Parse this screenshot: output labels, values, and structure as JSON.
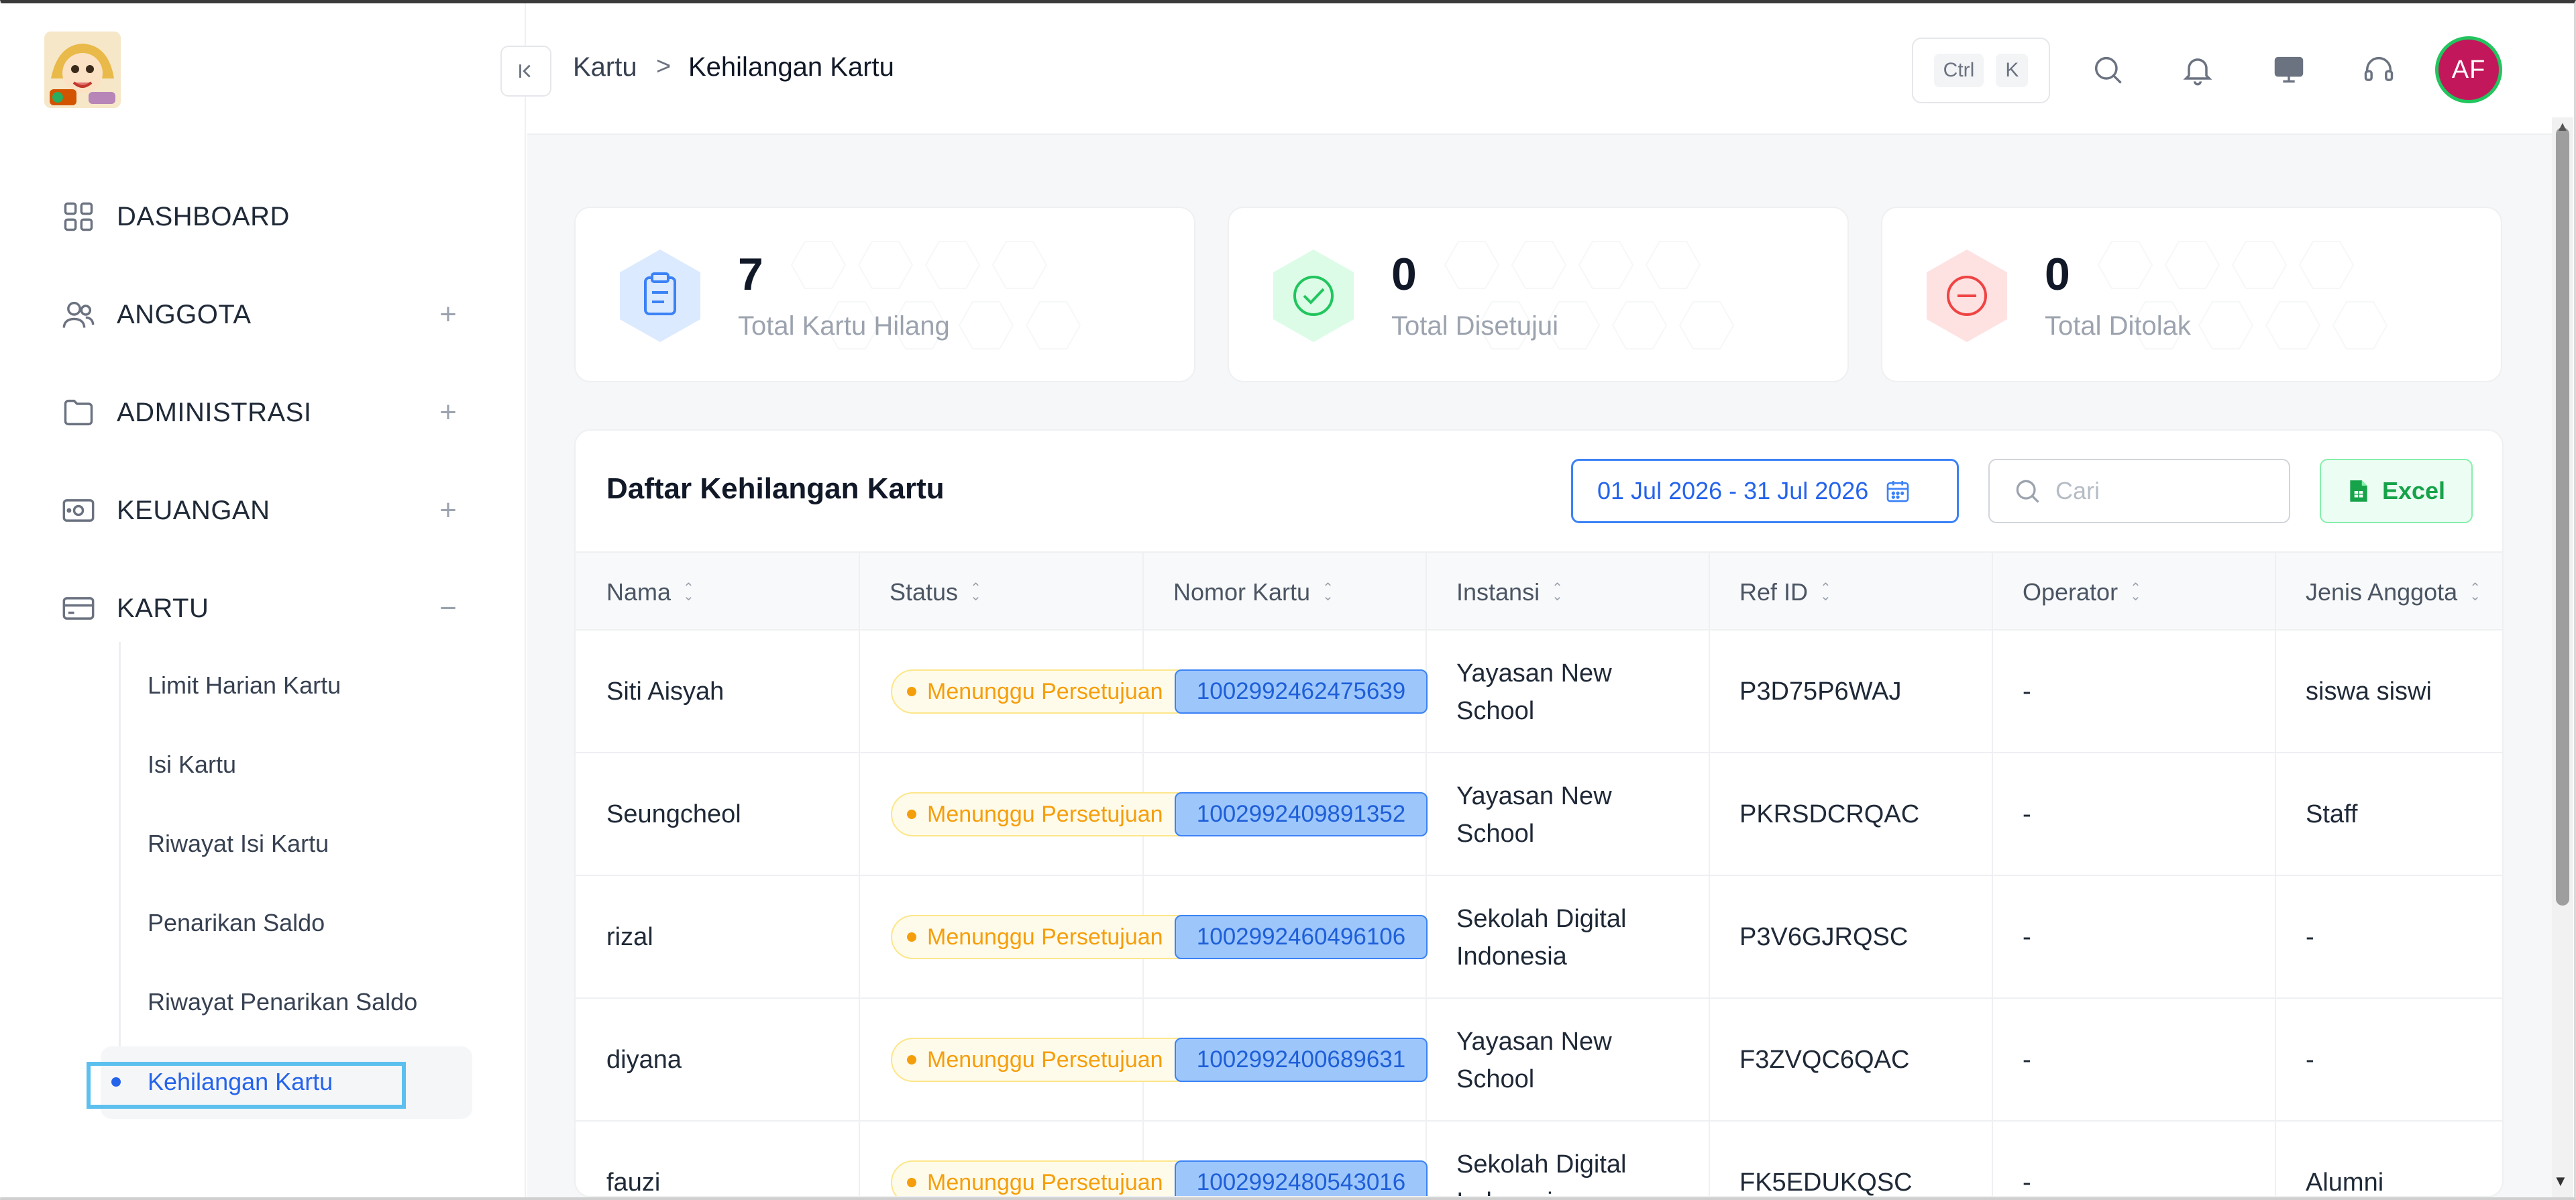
{
  "header": {
    "breadcrumb": [
      "Kartu",
      "Kehilangan Kartu"
    ],
    "breadcrumb_separator": ">",
    "shortcut_keys": [
      "Ctrl",
      "K"
    ],
    "avatar_initials": "AF"
  },
  "sidebar": {
    "items": [
      {
        "label": "DASHBOARD",
        "icon": "grid-icon"
      },
      {
        "label": "ANGGOTA",
        "icon": "users-icon",
        "toggle": "+"
      },
      {
        "label": "ADMINISTRASI",
        "icon": "folder-icon",
        "toggle": "+"
      },
      {
        "label": "KEUANGAN",
        "icon": "wallet-icon",
        "toggle": "+"
      },
      {
        "label": "KARTU",
        "icon": "card-icon",
        "toggle": "−"
      }
    ],
    "kartu_subitems": [
      "Limit Harian Kartu",
      "Isi Kartu",
      "Riwayat Isi Kartu",
      "Penarikan Saldo",
      "Riwayat Penarikan Saldo"
    ],
    "active_subitem": "Kehilangan Kartu"
  },
  "stats": [
    {
      "value": "7",
      "label": "Total Kartu Hilang",
      "color": "#3b82f6"
    },
    {
      "value": "0",
      "label": "Total Disetujui",
      "color": "#22c55e"
    },
    {
      "value": "0",
      "label": "Total Ditolak",
      "color": "#ef4444"
    }
  ],
  "panel": {
    "title": "Daftar Kehilangan Kartu",
    "date_range": "01 Jul 2026 - 31 Jul 2026",
    "search_placeholder": "Cari",
    "excel_label": "Excel"
  },
  "table": {
    "columns": [
      "Nama",
      "Status",
      "Nomor Kartu",
      "Instansi",
      "Ref ID",
      "Operator",
      "Jenis Anggota"
    ],
    "rows": [
      {
        "nama": "Siti Aisyah",
        "status": "Menunggu Persetujuan",
        "nomor": "1002992462475639",
        "instansi": [
          "Yayasan New",
          "School"
        ],
        "ref": "P3D75P6WAJ",
        "operator": "-",
        "jenis": "siswa siswi"
      },
      {
        "nama": "Seungcheol",
        "status": "Menunggu Persetujuan",
        "nomor": "1002992409891352",
        "instansi": [
          "Yayasan New",
          "School"
        ],
        "ref": "PKRSDCRQAC",
        "operator": "-",
        "jenis": "Staff"
      },
      {
        "nama": "rizal",
        "status": "Menunggu Persetujuan",
        "nomor": "1002992460496106",
        "instansi": [
          "Sekolah Digital",
          "Indonesia"
        ],
        "ref": "P3V6GJRQSC",
        "operator": "-",
        "jenis": "-"
      },
      {
        "nama": "diyana",
        "status": "Menunggu Persetujuan",
        "nomor": "1002992400689631",
        "instansi": [
          "Yayasan New",
          "School"
        ],
        "ref": "F3ZVQC6QAC",
        "operator": "-",
        "jenis": "-"
      },
      {
        "nama": "fauzi",
        "status": "Menunggu Persetujuan",
        "nomor": "1002992480543016",
        "instansi": [
          "Sekolah Digital",
          "Indonesia"
        ],
        "ref": "FK5EDUKQSC",
        "operator": "-",
        "jenis": "Alumni"
      }
    ]
  }
}
